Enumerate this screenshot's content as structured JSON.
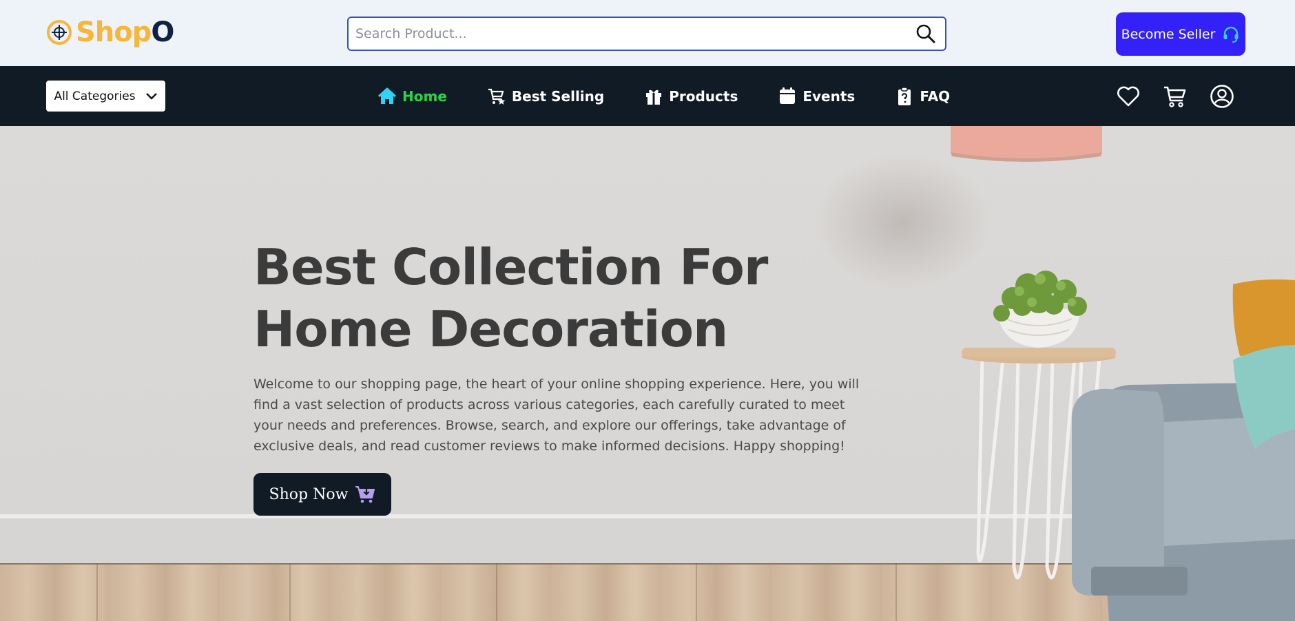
{
  "header": {
    "logo": {
      "part1": "Shop",
      "part2": "O"
    },
    "search": {
      "placeholder": "Search Product...",
      "value": ""
    },
    "seller_button": {
      "label": "Become Seller"
    }
  },
  "navbar": {
    "categories_button": {
      "label": "All Categories"
    },
    "items": [
      {
        "label": "Home",
        "icon": "home-icon",
        "active": true
      },
      {
        "label": "Best Selling",
        "icon": "cart-star-icon",
        "active": false
      },
      {
        "label": "Products",
        "icon": "gift-icon",
        "active": false
      },
      {
        "label": "Events",
        "icon": "calendar-icon",
        "active": false
      },
      {
        "label": "FAQ",
        "icon": "clipboard-question-icon",
        "active": false
      }
    ],
    "right_icons": [
      "heart-icon",
      "cart-icon",
      "user-icon"
    ]
  },
  "hero": {
    "title_line1": "Best Collection For",
    "title_line2": "Home Decoration",
    "description": "Welcome to our shopping page, the heart of your online shopping experience. Here, you will find a vast selection of products across various categories, each carefully curated to meet your needs and preferences. Browse, search, and explore our offerings, take advantage of exclusive deals, and read customer reviews to make informed decisions. Happy shopping!",
    "cta_label": "Shop Now"
  },
  "colors": {
    "accent": "#3321f7",
    "nav_bg": "#111b26",
    "active_nav": "#27d64a",
    "logo_yellow": "#f7b53a",
    "logo_navy": "#0f2240"
  }
}
